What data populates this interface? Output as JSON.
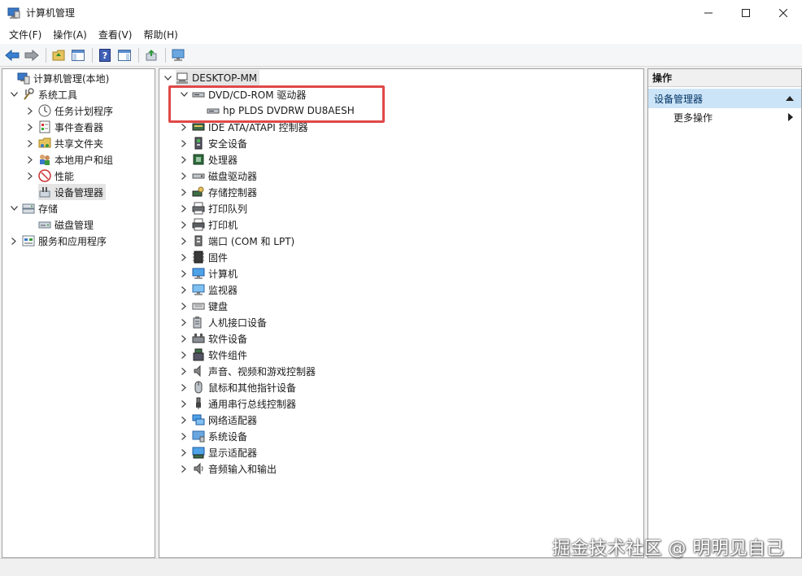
{
  "window": {
    "title": "计算机管理"
  },
  "menu": [
    "文件(F)",
    "操作(A)",
    "查看(V)",
    "帮助(H)"
  ],
  "left_tree": [
    {
      "label": "计算机管理(本地)",
      "indent": 0,
      "chev": "",
      "icon": "computer-management-icon"
    },
    {
      "label": "系统工具",
      "indent": 1,
      "chev": "down",
      "icon": "tools-icon"
    },
    {
      "label": "任务计划程序",
      "indent": 2,
      "chev": "right",
      "icon": "clock-icon"
    },
    {
      "label": "事件查看器",
      "indent": 2,
      "chev": "right",
      "icon": "event-viewer-icon"
    },
    {
      "label": "共享文件夹",
      "indent": 2,
      "chev": "right",
      "icon": "shared-folder-icon"
    },
    {
      "label": "本地用户和组",
      "indent": 2,
      "chev": "right",
      "icon": "users-icon"
    },
    {
      "label": "性能",
      "indent": 2,
      "chev": "right",
      "icon": "performance-icon"
    },
    {
      "label": "设备管理器",
      "indent": 2,
      "chev": "",
      "icon": "device-manager-icon",
      "selected": true
    },
    {
      "label": "存储",
      "indent": 1,
      "chev": "down",
      "icon": "storage-icon"
    },
    {
      "label": "磁盘管理",
      "indent": 2,
      "chev": "",
      "icon": "disk-management-icon"
    },
    {
      "label": "服务和应用程序",
      "indent": 1,
      "chev": "right",
      "icon": "services-icon"
    }
  ],
  "device_tree": {
    "root": "DESKTOP-MM",
    "expanded": {
      "label": "DVD/CD-ROM 驱动器",
      "child": "hp PLDS DVDRW  DU8AESH"
    },
    "categories": [
      {
        "label": "IDE ATA/ATAPI 控制器",
        "icon": "ide-controller-icon"
      },
      {
        "label": "安全设备",
        "icon": "security-device-icon"
      },
      {
        "label": "处理器",
        "icon": "processor-icon"
      },
      {
        "label": "磁盘驱动器",
        "icon": "disk-drive-icon"
      },
      {
        "label": "存储控制器",
        "icon": "storage-controller-icon"
      },
      {
        "label": "打印队列",
        "icon": "print-queue-icon"
      },
      {
        "label": "打印机",
        "icon": "printer-icon"
      },
      {
        "label": "端口 (COM 和 LPT)",
        "icon": "port-icon"
      },
      {
        "label": "固件",
        "icon": "firmware-icon"
      },
      {
        "label": "计算机",
        "icon": "computer-icon"
      },
      {
        "label": "监视器",
        "icon": "monitor-icon"
      },
      {
        "label": "键盘",
        "icon": "keyboard-icon"
      },
      {
        "label": "人机接口设备",
        "icon": "hid-icon"
      },
      {
        "label": "软件设备",
        "icon": "software-device-icon"
      },
      {
        "label": "软件组件",
        "icon": "software-component-icon"
      },
      {
        "label": "声音、视频和游戏控制器",
        "icon": "sound-icon"
      },
      {
        "label": "鼠标和其他指针设备",
        "icon": "mouse-icon"
      },
      {
        "label": "通用串行总线控制器",
        "icon": "usb-icon"
      },
      {
        "label": "网络适配器",
        "icon": "network-adapter-icon"
      },
      {
        "label": "系统设备",
        "icon": "system-device-icon"
      },
      {
        "label": "显示适配器",
        "icon": "display-adapter-icon"
      },
      {
        "label": "音频输入和输出",
        "icon": "audio-io-icon"
      }
    ]
  },
  "actions": {
    "header": "操作",
    "section": "设备管理器",
    "more": "更多操作"
  },
  "watermark": "掘金技术社区 @ 明明见自己",
  "colors": {
    "accent": "#cce4f7",
    "highlight_border": "#e04848"
  }
}
